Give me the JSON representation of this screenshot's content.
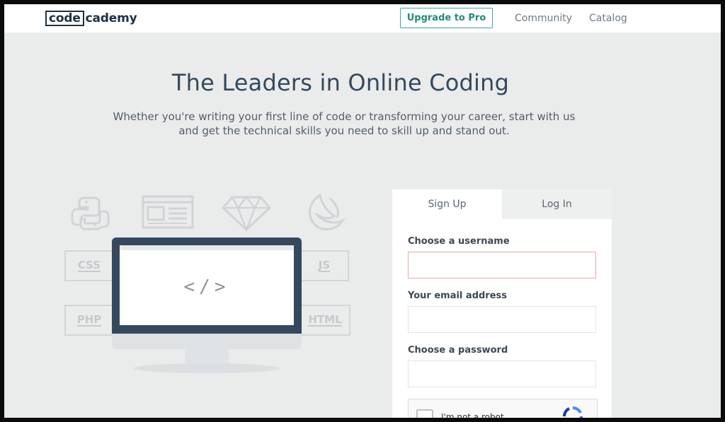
{
  "header": {
    "logo_boxed": "code",
    "logo_rest": "cademy",
    "upgrade_label": "Upgrade to Pro",
    "nav": [
      "Community",
      "Catalog"
    ]
  },
  "hero": {
    "title": "The Leaders in Online Coding",
    "subtitle_line1": "Whether you're writing your first line of code or transforming your career, start with us",
    "subtitle_line2": "and get the technical skills you need to skill up and stand out."
  },
  "illustration": {
    "icons": [
      "python-icon",
      "webpage-icon",
      "gem-icon",
      "swift-icon"
    ],
    "tags": [
      "CSS",
      "JS",
      "PHP",
      "HTML"
    ],
    "screen_glyph": "</>"
  },
  "auth": {
    "tabs": [
      "Sign Up",
      "Log In"
    ],
    "active_tab": "Sign Up",
    "username_label": "Choose a username",
    "username_value": "",
    "email_label": "Your email address",
    "email_value": "",
    "password_label": "Choose a password",
    "password_value": "",
    "captcha_label": "I'm not a robot"
  },
  "colors": {
    "accent": "#3aa892",
    "heading": "#34495e",
    "background": "#eaebeb",
    "error_border": "#e9a9a5"
  }
}
